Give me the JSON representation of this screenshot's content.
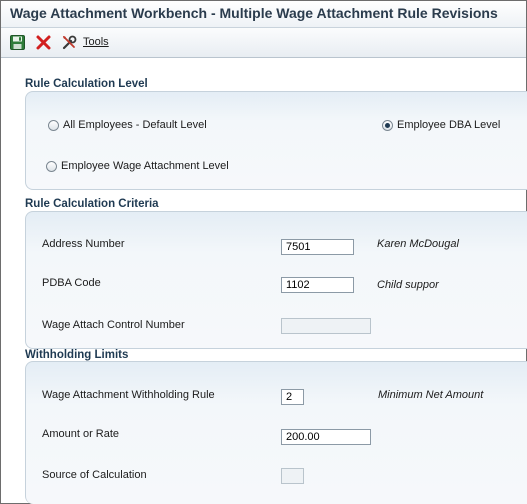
{
  "window": {
    "title": "Wage Attachment Workbench - Multiple Wage Attachment Rule Revisions"
  },
  "toolbar": {
    "save_icon": "save-icon",
    "cancel_icon": "close-icon",
    "tools_icon": "tools-icon",
    "tools_label": "Tools"
  },
  "rule_calc_level": {
    "title": "Rule Calculation Level",
    "options": [
      {
        "label": "All Employees - Default Level",
        "selected": false
      },
      {
        "label": "Employee DBA Level",
        "selected": true
      },
      {
        "label": "Employee Wage Attachment Level",
        "selected": false
      }
    ]
  },
  "rule_calc_criteria": {
    "title": "Rule Calculation Criteria",
    "address_number": {
      "label": "Address Number",
      "value": "7501",
      "description": "Karen McDougal"
    },
    "pdba_code": {
      "label": "PDBA Code",
      "value": "1102",
      "description": "Child suppor"
    },
    "control_number": {
      "label": "Wage Attach Control Number",
      "value": ""
    }
  },
  "withholding_limits": {
    "title": "Withholding Limits",
    "withholding_rule": {
      "label": "Wage Attachment Withholding Rule",
      "value": "2",
      "description": "Minimum Net Amount"
    },
    "amount_or_rate": {
      "label": "Amount or Rate",
      "value": "200.00"
    },
    "source_of_calc": {
      "label": "Source of Calculation",
      "value": ""
    }
  },
  "colors": {
    "accent": "#1f3a52",
    "cancel_red": "#d21f1f",
    "save_green": "#2f7d3a"
  }
}
